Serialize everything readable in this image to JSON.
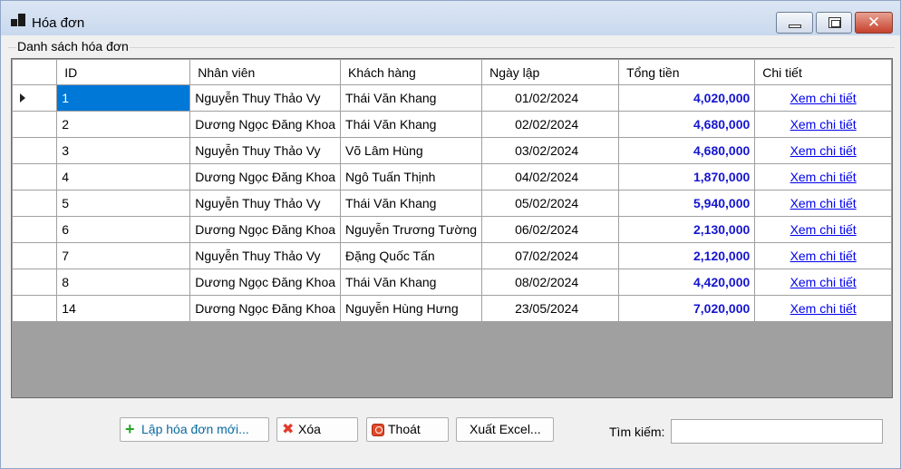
{
  "window": {
    "title": "Hóa đơn",
    "close_glyph": "✕"
  },
  "group": {
    "title": "Danh sách hóa đơn"
  },
  "grid": {
    "columns": [
      "ID",
      "Nhân viên",
      "Khách hàng",
      "Ngày lập",
      "Tổng tiền",
      "Chi tiết"
    ],
    "rows": [
      {
        "id": "1",
        "staff": "Nguyễn Thuy Thảo Vy",
        "customer": "Thái Văn Khang",
        "date": "01/02/2024",
        "total": "4,020,000",
        "detail": "Xem chi tiết"
      },
      {
        "id": "2",
        "staff": "Dương Ngọc Đăng Khoa",
        "customer": "Thái Văn Khang",
        "date": "02/02/2024",
        "total": "4,680,000",
        "detail": "Xem chi tiết"
      },
      {
        "id": "3",
        "staff": "Nguyễn Thuy Thảo Vy",
        "customer": "Võ Lâm Hùng",
        "date": "03/02/2024",
        "total": "4,680,000",
        "detail": "Xem chi tiết"
      },
      {
        "id": "4",
        "staff": "Dương Ngọc Đăng Khoa",
        "customer": "Ngô Tuấn Thịnh",
        "date": "04/02/2024",
        "total": "1,870,000",
        "detail": "Xem chi tiết"
      },
      {
        "id": "5",
        "staff": "Nguyễn Thuy Thảo Vy",
        "customer": "Thái Văn Khang",
        "date": "05/02/2024",
        "total": "5,940,000",
        "detail": "Xem chi tiết"
      },
      {
        "id": "6",
        "staff": "Dương Ngọc Đăng Khoa",
        "customer": "Nguyễn Trương Tường",
        "date": "06/02/2024",
        "total": "2,130,000",
        "detail": "Xem chi tiết"
      },
      {
        "id": "7",
        "staff": "Nguyễn Thuy Thảo Vy",
        "customer": "Đặng Quốc Tấn",
        "date": "07/02/2024",
        "total": "2,120,000",
        "detail": "Xem chi tiết"
      },
      {
        "id": "8",
        "staff": "Dương Ngọc Đăng Khoa",
        "customer": "Thái Văn Khang",
        "date": "08/02/2024",
        "total": "4,420,000",
        "detail": "Xem chi tiết"
      },
      {
        "id": "14",
        "staff": "Dương Ngọc Đăng Khoa",
        "customer": "Nguyễn Hùng Hưng",
        "date": "23/05/2024",
        "total": "7,020,000",
        "detail": "Xem chi tiết"
      }
    ]
  },
  "buttons": {
    "add": {
      "label": "Lập hóa đơn mới...",
      "icon": "plus-icon"
    },
    "delete": {
      "label": "Xóa",
      "icon": "x-icon"
    },
    "exit": {
      "label": "Thoát",
      "icon": "power-icon"
    },
    "export": {
      "label": "Xuất Excel..."
    }
  },
  "search": {
    "label": "Tìm kiếm:",
    "value": ""
  },
  "colors": {
    "selection": "#0078d7",
    "total_text": "#1515d0",
    "link": "#0000ee",
    "grid_empty": "#a0a0a0"
  }
}
